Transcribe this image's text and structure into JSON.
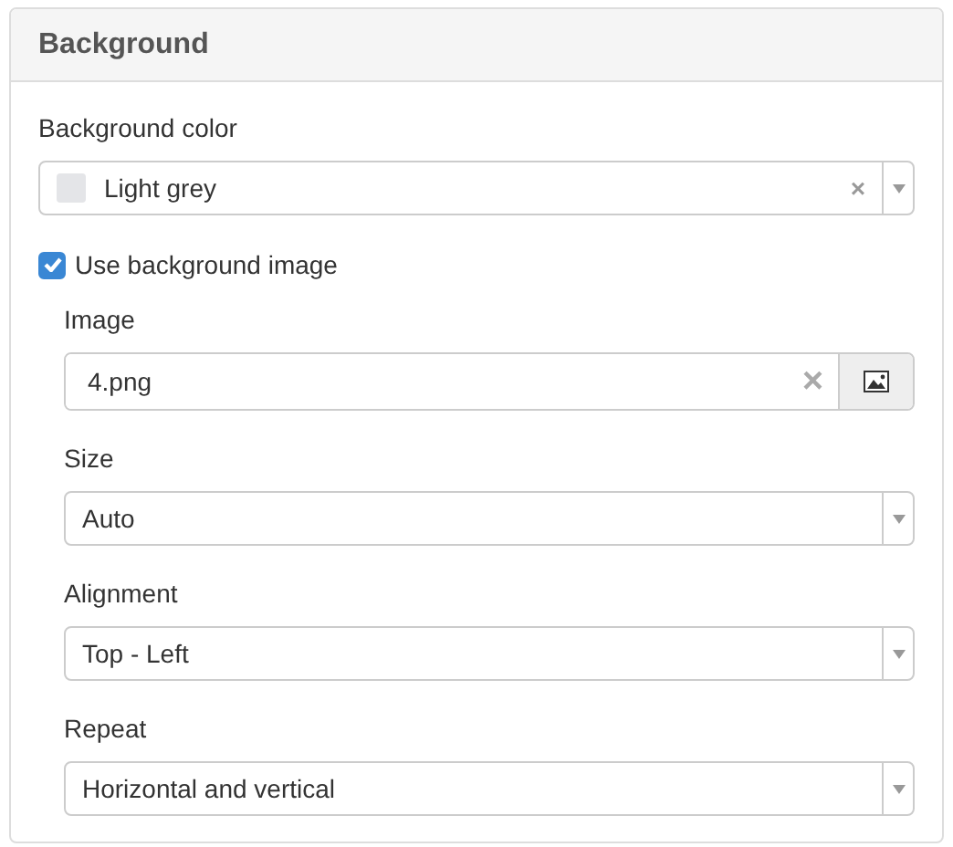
{
  "panel": {
    "title": "Background"
  },
  "background_color": {
    "label": "Background color",
    "value": "Light grey",
    "color": "#e4e5e8",
    "clear": "×"
  },
  "use_image": {
    "label": "Use background image",
    "checked": true
  },
  "image": {
    "label": "Image",
    "value": "4.png",
    "clear": "×"
  },
  "selects": [
    {
      "label": "Size",
      "value": "Auto"
    },
    {
      "label": "Alignment",
      "value": "Top - Left"
    },
    {
      "label": "Repeat",
      "value": "Horizontal and vertical"
    }
  ]
}
